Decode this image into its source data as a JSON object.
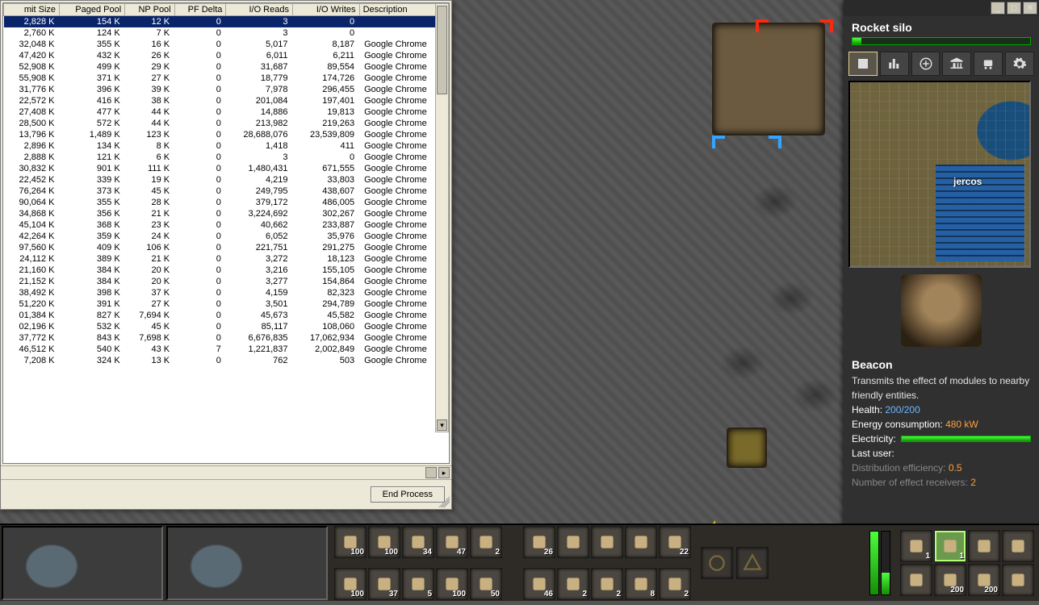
{
  "procwin": {
    "columns": [
      "mit Size",
      "Paged Pool",
      "NP Pool",
      "PF Delta",
      "I/O Reads",
      "I/O Writes",
      "Description"
    ],
    "end_process_label": "End Process",
    "selected_row_index": 0,
    "rows": [
      {
        "c": [
          "2,828 K",
          "154 K",
          "12 K",
          "0",
          "3",
          "0",
          ""
        ]
      },
      {
        "c": [
          "2,760 K",
          "124 K",
          "7 K",
          "0",
          "3",
          "0",
          ""
        ]
      },
      {
        "c": [
          "32,048 K",
          "355 K",
          "16 K",
          "0",
          "5,017",
          "8,187",
          "Google Chrome"
        ]
      },
      {
        "c": [
          "47,420 K",
          "432 K",
          "26 K",
          "0",
          "6,011",
          "6,211",
          "Google Chrome"
        ]
      },
      {
        "c": [
          "52,908 K",
          "499 K",
          "29 K",
          "0",
          "31,687",
          "89,554",
          "Google Chrome"
        ]
      },
      {
        "c": [
          "55,908 K",
          "371 K",
          "27 K",
          "0",
          "18,779",
          "174,726",
          "Google Chrome"
        ]
      },
      {
        "c": [
          "31,776 K",
          "396 K",
          "39 K",
          "0",
          "7,978",
          "296,455",
          "Google Chrome"
        ]
      },
      {
        "c": [
          "22,572 K",
          "416 K",
          "38 K",
          "0",
          "201,084",
          "197,401",
          "Google Chrome"
        ]
      },
      {
        "c": [
          "27,408 K",
          "477 K",
          "44 K",
          "0",
          "14,886",
          "19,813",
          "Google Chrome"
        ]
      },
      {
        "c": [
          "28,500 K",
          "572 K",
          "44 K",
          "0",
          "213,982",
          "219,263",
          "Google Chrome"
        ]
      },
      {
        "c": [
          "13,796 K",
          "1,489 K",
          "123 K",
          "0",
          "28,688,076",
          "23,539,809",
          "Google Chrome"
        ]
      },
      {
        "c": [
          "2,896 K",
          "134 K",
          "8 K",
          "0",
          "1,418",
          "411",
          "Google Chrome"
        ]
      },
      {
        "c": [
          "2,888 K",
          "121 K",
          "6 K",
          "0",
          "3",
          "0",
          "Google Chrome"
        ]
      },
      {
        "c": [
          "30,832 K",
          "901 K",
          "111 K",
          "0",
          "1,480,431",
          "671,555",
          "Google Chrome"
        ]
      },
      {
        "c": [
          "22,452 K",
          "339 K",
          "19 K",
          "0",
          "4,219",
          "33,803",
          "Google Chrome"
        ]
      },
      {
        "c": [
          "76,264 K",
          "373 K",
          "45 K",
          "0",
          "249,795",
          "438,607",
          "Google Chrome"
        ]
      },
      {
        "c": [
          "90,064 K",
          "355 K",
          "28 K",
          "0",
          "379,172",
          "486,005",
          "Google Chrome"
        ]
      },
      {
        "c": [
          "34,868 K",
          "356 K",
          "21 K",
          "0",
          "3,224,692",
          "302,267",
          "Google Chrome"
        ]
      },
      {
        "c": [
          "45,104 K",
          "368 K",
          "23 K",
          "0",
          "40,662",
          "233,887",
          "Google Chrome"
        ]
      },
      {
        "c": [
          "42,264 K",
          "359 K",
          "24 K",
          "0",
          "6,052",
          "35,976",
          "Google Chrome"
        ]
      },
      {
        "c": [
          "97,560 K",
          "409 K",
          "106 K",
          "0",
          "221,751",
          "291,275",
          "Google Chrome"
        ]
      },
      {
        "c": [
          "24,112 K",
          "389 K",
          "21 K",
          "0",
          "3,272",
          "18,123",
          "Google Chrome"
        ]
      },
      {
        "c": [
          "21,160 K",
          "384 K",
          "20 K",
          "0",
          "3,216",
          "155,105",
          "Google Chrome"
        ]
      },
      {
        "c": [
          "21,152 K",
          "384 K",
          "20 K",
          "0",
          "3,277",
          "154,864",
          "Google Chrome"
        ]
      },
      {
        "c": [
          "38,492 K",
          "398 K",
          "37 K",
          "0",
          "4,159",
          "82,323",
          "Google Chrome"
        ]
      },
      {
        "c": [
          "51,220 K",
          "391 K",
          "27 K",
          "0",
          "3,501",
          "294,789",
          "Google Chrome"
        ]
      },
      {
        "c": [
          "01,384 K",
          "827 K",
          "7,694 K",
          "0",
          "45,673",
          "45,582",
          "Google Chrome"
        ]
      },
      {
        "c": [
          "02,196 K",
          "532 K",
          "45 K",
          "0",
          "85,117",
          "108,060",
          "Google Chrome"
        ]
      },
      {
        "c": [
          "37,772 K",
          "843 K",
          "7,698 K",
          "0",
          "6,676,835",
          "17,062,934",
          "Google Chrome"
        ]
      },
      {
        "c": [
          "46,512 K",
          "540 K",
          "43 K",
          "7",
          "1,221,837",
          "2,002,849",
          "Google Chrome"
        ]
      },
      {
        "c": [
          "7,208 K",
          "324 K",
          "13 K",
          "0",
          "762",
          "503",
          "Google Chrome"
        ]
      }
    ]
  },
  "side": {
    "window_buttons": {
      "min": "_",
      "max": "□",
      "close": "✕"
    },
    "title": "Rocket silo",
    "tabs": [
      "map",
      "production",
      "add",
      "research",
      "train",
      "cog"
    ],
    "minimap_player": "jercos",
    "entity": {
      "name": "Beacon",
      "desc": "Transmits the effect of modules to nearby friendly entities.",
      "health_label": "Health:",
      "health_value": "200/200",
      "energy_label": "Energy consumption:",
      "energy_value": "480 kW",
      "electricity_label": "Electricity:",
      "lastuser_label": "Last user:",
      "lastuser_value": "",
      "dist_label": "Distribution efficiency:",
      "dist_value": "0.5",
      "recv_label": "Number of effect receivers:",
      "recv_value": "2"
    }
  },
  "hotbar": {
    "row1": [
      {
        "name": "belt",
        "count": "100"
      },
      {
        "name": "splitter",
        "count": "100"
      },
      {
        "name": "fast-belt",
        "count": "34"
      },
      {
        "name": "underground-belt",
        "count": "47"
      },
      {
        "name": "inserter",
        "count": "2"
      }
    ],
    "row2": [
      {
        "name": "rail",
        "count": "100"
      },
      {
        "name": "signal",
        "count": "37"
      },
      {
        "name": "chain-signal",
        "count": "5"
      },
      {
        "name": "train-stop",
        "count": "100"
      },
      {
        "name": "locomotive",
        "count": "50"
      }
    ],
    "group2_row1": [
      {
        "name": "iron-plate",
        "count": "26"
      },
      {
        "name": "copper-plate",
        "count": ""
      },
      {
        "name": "steel",
        "count": ""
      },
      {
        "name": "plastic",
        "count": ""
      },
      {
        "name": "green-circuit",
        "count": "22"
      }
    ],
    "group2_row2": [
      {
        "name": "gear",
        "count": "46"
      },
      {
        "name": "pipe",
        "count": "2"
      },
      {
        "name": "pipe-to-ground",
        "count": "2"
      },
      {
        "name": "engine",
        "count": "8"
      },
      {
        "name": "electric-engine",
        "count": "2"
      }
    ],
    "equip": [
      {
        "name": "pickaxe",
        "count": "1",
        "hi": false
      },
      {
        "name": "repair-pack",
        "count": "1",
        "hi": true
      },
      {
        "name": "pistol",
        "count": "",
        "hi": false
      },
      {
        "name": "smg",
        "count": "",
        "hi": false
      },
      {
        "name": "armor",
        "count": "",
        "hi": false
      },
      {
        "name": "ammo",
        "count": "200",
        "hi": false
      },
      {
        "name": "piercing-ammo",
        "count": "200",
        "hi": false
      },
      {
        "name": "shotgun-shells",
        "count": "",
        "hi": false
      }
    ],
    "gauges": [
      100,
      35
    ]
  }
}
